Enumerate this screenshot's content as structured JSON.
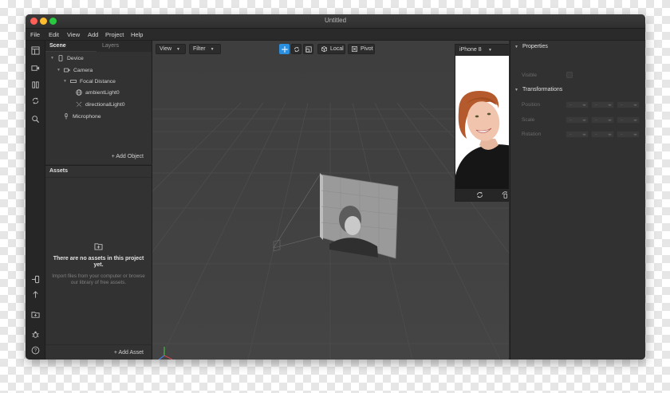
{
  "window": {
    "title": "Untitled"
  },
  "menu": [
    "File",
    "Edit",
    "View",
    "Add",
    "Project",
    "Help"
  ],
  "scene": {
    "tab_scene": "Scene",
    "tab_layers": "Layers",
    "tree": [
      {
        "label": "Device",
        "icon": "phone-icon"
      },
      {
        "label": "Camera",
        "icon": "camera-icon"
      },
      {
        "label": "Focal Distance",
        "icon": "focal-icon"
      },
      {
        "label": "ambientLight0",
        "icon": "globe-icon"
      },
      {
        "label": "directionalLight0",
        "icon": "light-icon"
      },
      {
        "label": "Microphone",
        "icon": "microphone-icon"
      }
    ],
    "add_object": "+ Add Object"
  },
  "assets": {
    "title": "Assets",
    "empty_title": "There are no assets in this project yet.",
    "empty_sub": "Import files from your computer or browse our library of free assets.",
    "add_asset": "+ Add Asset"
  },
  "viewport": {
    "view_label": "View",
    "filter_label": "Filter",
    "local_label": "Local",
    "pivot_label": "Pivot",
    "accent_color": "#2b8fe0"
  },
  "preview": {
    "device": "iPhone 8"
  },
  "properties": {
    "title": "Properties",
    "visible_label": "Visible",
    "transformations_title": "Transformations",
    "rows": [
      "Position",
      "Scale",
      "Rotation"
    ],
    "field_placeholder": "–"
  }
}
